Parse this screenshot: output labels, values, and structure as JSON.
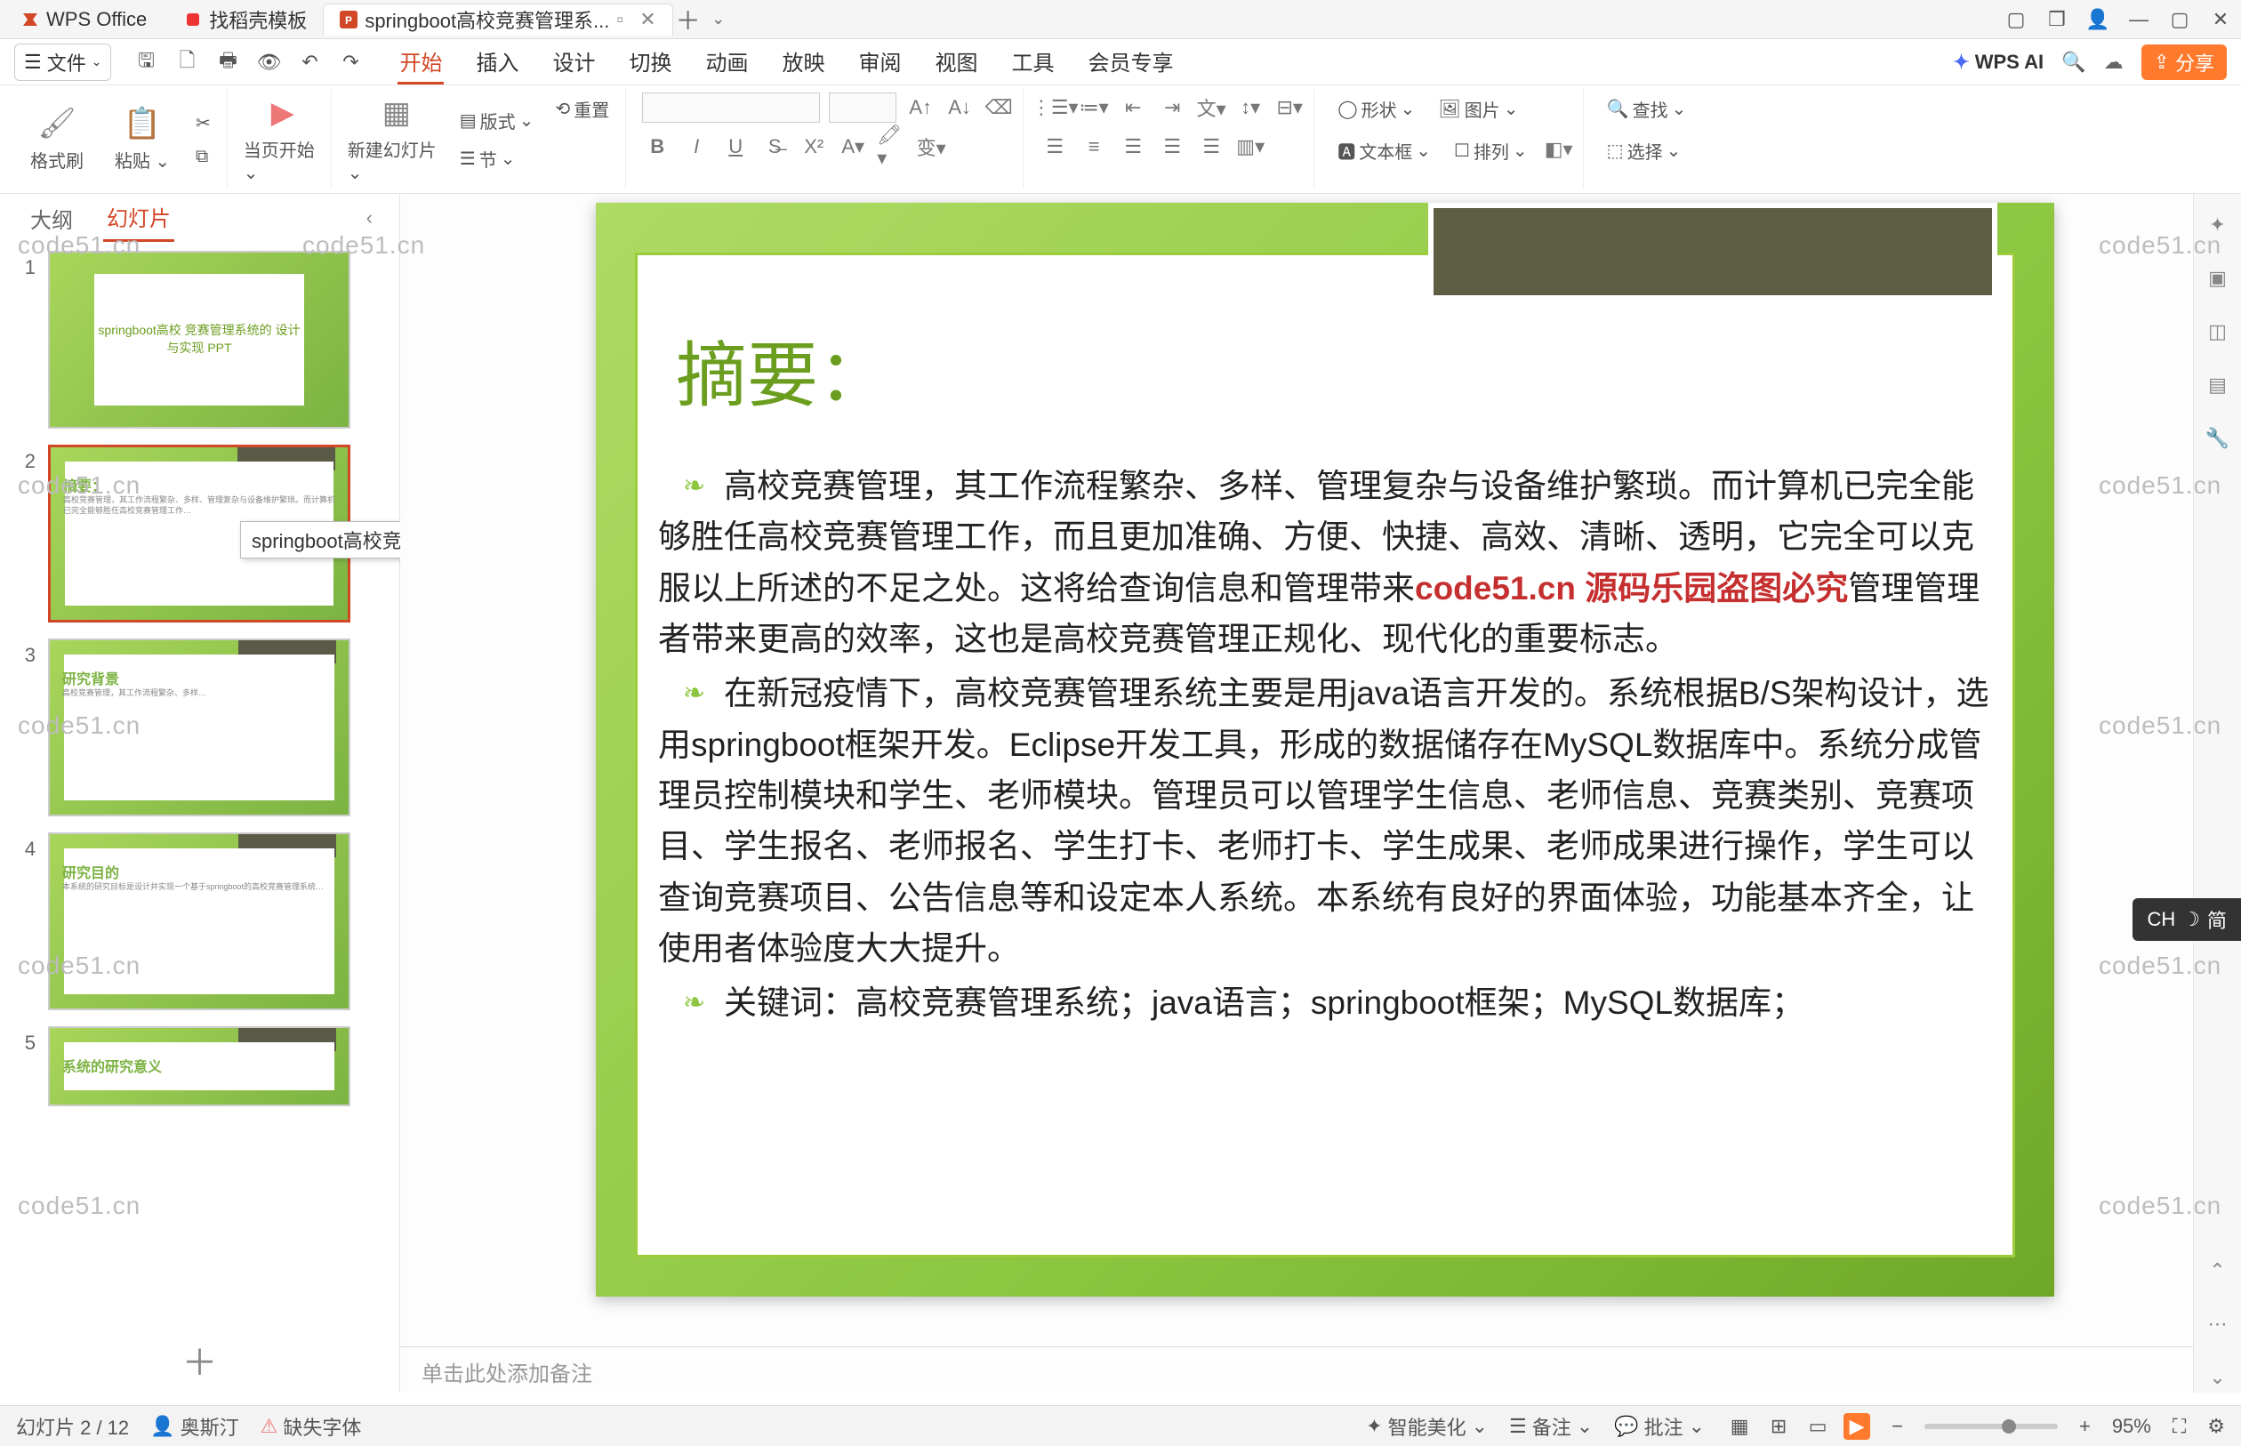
{
  "titlebar": {
    "app_name": "WPS Office",
    "template_tab": "找稻壳模板",
    "doc_tab": "springboot高校竞赛管理系...",
    "doc_tooltip": "springboot高校竞..."
  },
  "menubar": {
    "file": "文件",
    "tabs": [
      "开始",
      "插入",
      "设计",
      "切换",
      "动画",
      "放映",
      "审阅",
      "视图",
      "工具",
      "会员专享"
    ],
    "active_tab": 0,
    "wps_ai": "WPS AI",
    "share": "分享"
  },
  "ribbon": {
    "format_painter": "格式刷",
    "paste": "粘贴",
    "from_current": "当页开始",
    "new_slide": "新建幻灯片",
    "layout": "版式",
    "section": "节",
    "reset": "重置",
    "shape": "形状",
    "picture": "图片",
    "textbox": "文本框",
    "arrange": "排列",
    "find": "查找",
    "select": "选择"
  },
  "side_panel": {
    "outline": "大纲",
    "slides": "幻灯片",
    "active": 1,
    "thumbs": [
      {
        "num": "1",
        "title": "springboot高校\n竞赛管理系统的\n设计与实现 PPT"
      },
      {
        "num": "2",
        "title": "摘要："
      },
      {
        "num": "3",
        "title": "研究背景"
      },
      {
        "num": "4",
        "title": "研究目的"
      },
      {
        "num": "5",
        "title": "系统的研究意义"
      }
    ]
  },
  "slide": {
    "title": "摘要：",
    "para1_a": "高校竞赛管理，其工作流程繁杂、多样、管理复杂与设备维护繁琐。而计算机已完全能够胜任高校竞赛管理工作，而且更加准确、方便、快捷、高效、清晰、透明，它完全可以克服以上所述的不足之处。这将给查询信息和管理带来",
    "red_overlay": "code51.cn 源码乐园盗图必究",
    "para1_b": "管理管理者带来更高的效率，这也是高校竞赛管理正规化、现代化的重要标志。",
    "para2": "在新冠疫情下，高校竞赛管理系统主要是用java语言开发的。系统根据B/S架构设计，选用springboot框架开发。Eclipse开发工具，形成的数据储存在MySQL数据库中。系统分成管理员控制模块和学生、老师模块。管理员可以管理学生信息、老师信息、竞赛类别、竞赛项目、学生报名、老师报名、学生打卡、老师打卡、学生成果、老师成果进行操作，学生可以查询竞赛项目、公告信息等和设定本人系统。本系统有良好的界面体验，功能基本齐全，让使用者体验度大大提升。",
    "para3": "关键词：高校竞赛管理系统；java语言；springboot框架；MySQL数据库；",
    "notes_placeholder": "单击此处添加备注"
  },
  "ime": {
    "lang": "CH",
    "mode": "简"
  },
  "statusbar": {
    "slide_pos": "幻灯片 2 / 12",
    "author": "奥斯汀",
    "missing_font": "缺失字体",
    "beautify": "智能美化",
    "notes": "备注",
    "review": "批注",
    "zoom": "95%"
  },
  "watermark": "code51.cn"
}
